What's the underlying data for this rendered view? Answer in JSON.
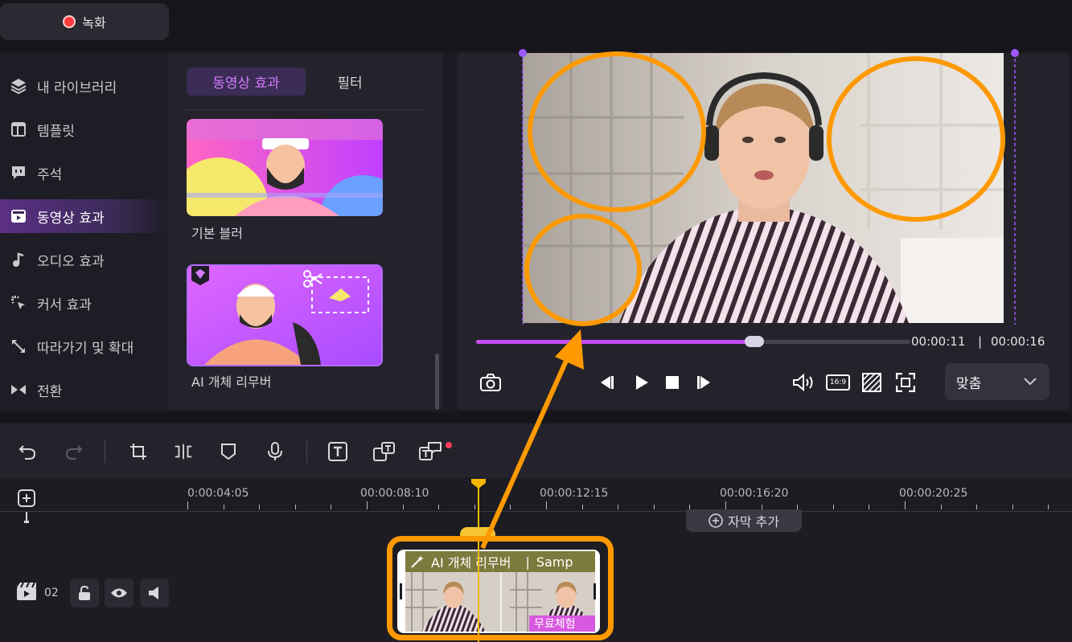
{
  "header": {
    "record_label": "녹화"
  },
  "sidebar": {
    "items": [
      {
        "label": "내 라이브러리",
        "icon": "layers-icon"
      },
      {
        "label": "템플릿",
        "icon": "template-icon"
      },
      {
        "label": "주석",
        "icon": "comment-icon"
      },
      {
        "label": "동영상 효과",
        "icon": "video-effects-icon"
      },
      {
        "label": "오디오 효과",
        "icon": "music-note-icon"
      },
      {
        "label": "커서 효과",
        "icon": "cursor-sparkle-icon"
      },
      {
        "label": "따라가기 및 확대",
        "icon": "expand-arrows-icon"
      },
      {
        "label": "전환",
        "icon": "transition-icon"
      }
    ],
    "active_index": 3
  },
  "effects_panel": {
    "tabs": [
      "동영상 효과",
      "필터"
    ],
    "active_tab": 0,
    "items": [
      {
        "label": "기본 블러",
        "icon": "blur-thumbnail"
      },
      {
        "label": "AI 개체 리무버",
        "icon": "ai-remover-thumbnail",
        "premium": true
      }
    ]
  },
  "preview": {
    "current_time": "00:00:11",
    "separator": "|",
    "total_time": "00:00:16",
    "progress_fraction": 0.64,
    "fit_option": "맞춤",
    "aspect_ratio_label": "16:9"
  },
  "timeline": {
    "ruler_labels": [
      "0:00:04:05",
      "00:00:08:10",
      "00:00:12:15",
      "00:00:16:20",
      "00:00:20:25"
    ],
    "add_subtitle_label": "자막 추가",
    "track_number": "02",
    "clip": {
      "effect_label": "AI 개체 리무버",
      "separator": "|",
      "name_label": "Samp",
      "trial_badge": "무료체험"
    }
  },
  "colors": {
    "accent": "#c54cf2",
    "annotation": "#ff9900",
    "playhead": "#f5b700",
    "record": "#ff3b3b"
  }
}
